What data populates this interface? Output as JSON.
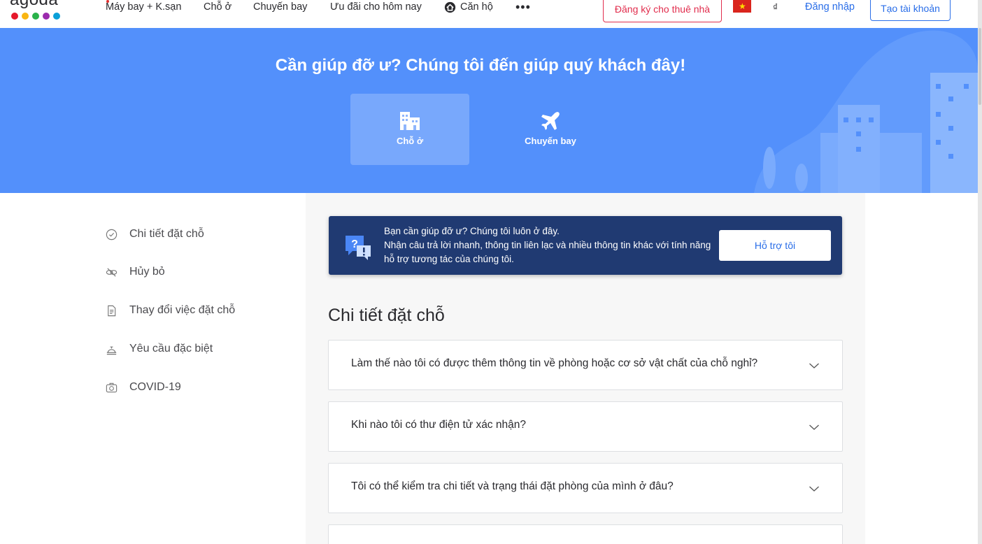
{
  "logo": {
    "text": "agoda",
    "dot_colors": [
      "#e6192b",
      "#f9b512",
      "#2ab24a",
      "#9b2bad",
      "#0aa0d8"
    ]
  },
  "topnav": {
    "items": [
      "Máy bay + K.sạn",
      "Chỗ ở",
      "Chuyến bay",
      "Ưu đãi cho hôm nay",
      "Căn hộ"
    ],
    "more": "•••",
    "host_button": "Đăng ký cho thuê nhà",
    "currency": "₫",
    "login": "Đăng nhập",
    "signup": "Tạo tài khoản"
  },
  "hero": {
    "title": "Cần giúp đỡ ư? Chúng tôi đến giúp quý khách đây!",
    "tabs": [
      {
        "label": "Chỗ ở",
        "icon": "hotel-icon",
        "active": true
      },
      {
        "label": "Chuyến bay",
        "icon": "airplane-icon",
        "active": false
      }
    ]
  },
  "sidebar": {
    "items": [
      {
        "label": "Chi tiết đặt chỗ",
        "icon": "check-circle-icon"
      },
      {
        "label": "Hủy bỏ",
        "icon": "cancel-link-icon"
      },
      {
        "label": "Thay đổi việc đặt chỗ",
        "icon": "document-icon"
      },
      {
        "label": "Yêu cầu đặc biệt",
        "icon": "service-bell-icon"
      },
      {
        "label": "COVID-19",
        "icon": "medical-kit-icon"
      }
    ]
  },
  "help_banner": {
    "line1": "Bạn cần giúp đỡ ư? Chúng tôi luôn ở đây.",
    "line2": "Nhận câu trả lời nhanh, thông tin liên lạc và nhiều thông tin khác với tính năng hỗ trợ tương tác của chúng tôi.",
    "button": "Hỗ trợ tôi"
  },
  "section": {
    "title": "Chi tiết đặt chỗ"
  },
  "faqs": [
    "Làm thế nào tôi có được thêm thông tin về phòng hoặc cơ sở vật chất của chỗ nghỉ?",
    "Khi nào tôi có thư điện tử xác nhận?",
    "Tôi có thể kiểm tra chi tiết và trạng thái đặt phòng của mình ở đâu?"
  ],
  "colors": {
    "hero_bg": "#5390fb",
    "banner_bg": "#203a72",
    "link_blue": "#2a6ee8",
    "host_red": "#e12d4d"
  }
}
